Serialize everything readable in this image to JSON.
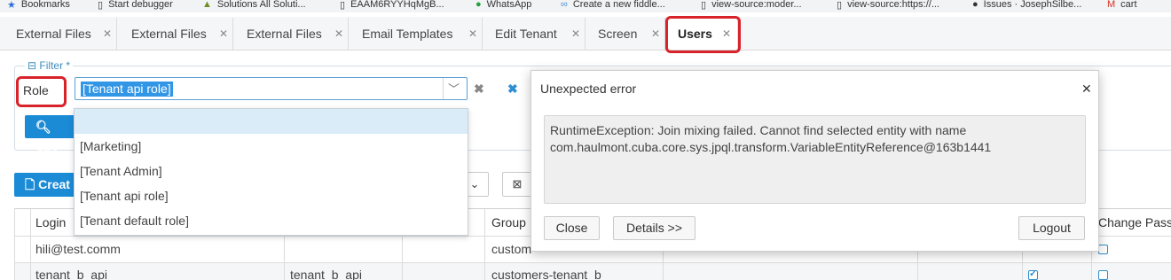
{
  "bookmarks": [
    {
      "label": "Bookmarks",
      "icon": "star-icon"
    },
    {
      "label": "Start debugger",
      "icon": "page-icon"
    },
    {
      "label": "Solutions All Soluti...",
      "icon": "logo-icon"
    },
    {
      "label": "EAAM6RYYHqMgB...",
      "icon": "page-icon"
    },
    {
      "label": "WhatsApp",
      "icon": "whatsapp-icon"
    },
    {
      "label": "Create a new fiddle...",
      "icon": "fiddle-icon"
    },
    {
      "label": "view-source:moder...",
      "icon": "page-icon"
    },
    {
      "label": "view-source:https://...",
      "icon": "page-icon"
    },
    {
      "label": "Issues · JosephSilbe...",
      "icon": "github-icon"
    },
    {
      "label": "cart",
      "icon": "gmail-icon"
    }
  ],
  "tabs": [
    {
      "label": "External Files"
    },
    {
      "label": "External Files"
    },
    {
      "label": "External Files"
    },
    {
      "label": "Email Templates"
    },
    {
      "label": "Edit Tenant"
    },
    {
      "label": "Screen"
    },
    {
      "label": "Users"
    }
  ],
  "filter": {
    "legend": "Filter *",
    "condition_label": "Role",
    "selected_value": "[Tenant api role]",
    "search_label": "Sea",
    "options": [
      "",
      "[Marketing]",
      "[Tenant Admin]",
      "[Tenant api role]",
      "[Tenant default role]"
    ]
  },
  "toolbar": {
    "create_label": "Creat"
  },
  "table": {
    "headers": {
      "login": "Login",
      "group": "Group",
      "change_pass": "Change Pass"
    },
    "rows": [
      {
        "login": "hili@test.comm",
        "name": "",
        "group": "custom",
        "active": false,
        "change": false
      },
      {
        "login": "tenant_b_api",
        "name": "tenant_b_api",
        "group": "customers-tenant_b",
        "active": true,
        "change": false
      }
    ]
  },
  "dialog": {
    "title": "Unexpected error",
    "message_line1": "RuntimeException: Join mixing failed. Cannot find selected entity with name",
    "message_line2": "com.haulmont.cuba.core.sys.jpql.transform.VariableEntityReference@163b1441",
    "close_label": "Close",
    "details_label": "Details >>",
    "logout_label": "Logout"
  },
  "colors": {
    "accent": "#1b8bd6",
    "highlight": "#d9ecf8",
    "annotation": "#d8232a"
  }
}
